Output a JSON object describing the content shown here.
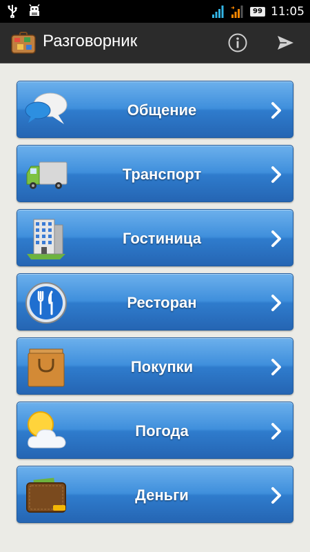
{
  "status_bar": {
    "time": "11:05",
    "battery": "99",
    "icons": [
      "usb-icon",
      "android-debug-icon",
      "signal-icon",
      "signal-icon",
      "battery-icon"
    ]
  },
  "action_bar": {
    "title": "Разговорник",
    "icons": [
      "suitcase-icon",
      "info-icon",
      "send-icon"
    ]
  },
  "menu": {
    "items": [
      {
        "label": "Общение",
        "icon": "chat-bubbles-icon"
      },
      {
        "label": "Транспорт",
        "icon": "truck-icon"
      },
      {
        "label": "Гостиница",
        "icon": "hotel-building-icon"
      },
      {
        "label": "Ресторан",
        "icon": "fork-knife-icon"
      },
      {
        "label": "Покупки",
        "icon": "shopping-bag-icon"
      },
      {
        "label": "Погода",
        "icon": "sun-cloud-icon"
      },
      {
        "label": "Деньги",
        "icon": "wallet-icon"
      }
    ]
  },
  "colors": {
    "status_bar": "#000000",
    "action_bar": "#2b2b2b",
    "background": "#ebebe6",
    "button_top": "#6cb0ec",
    "button_bottom": "#2565b3",
    "signal_blue": "#33b5e5",
    "signal_orange": "#ff8800"
  }
}
